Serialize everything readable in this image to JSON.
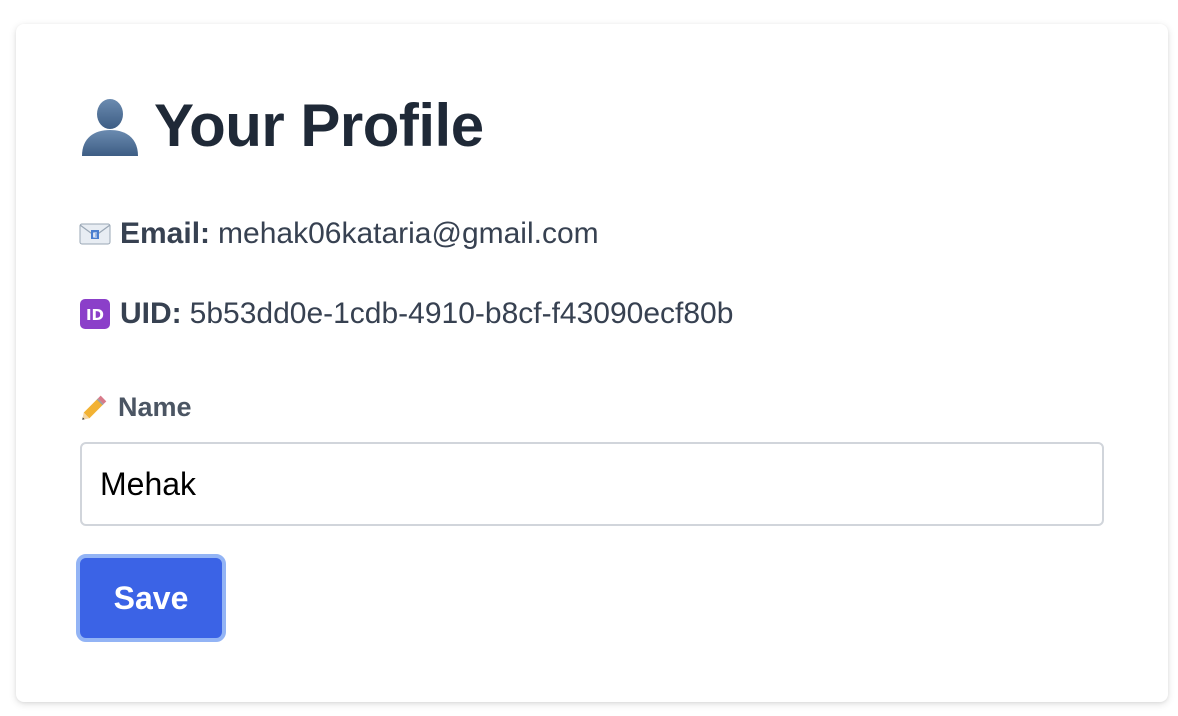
{
  "profile": {
    "title": "Your Profile",
    "title_icon": "user-silhouette-icon",
    "email_label": "Email:",
    "email_value": "mehak06kataria@gmail.com",
    "email_icon": "envelope-icon",
    "uid_label": "UID:",
    "uid_value": "5b53dd0e-1cdb-4910-b8cf-f43090ecf80b",
    "uid_icon": "id-badge-icon",
    "name_label": "Name",
    "name_icon": "pencil-icon",
    "name_value": "Mehak",
    "save_label": "Save"
  },
  "colors": {
    "primary": "#3b63e6",
    "focus_ring": "#93b4f5",
    "heading": "#1f2937",
    "text": "#374151",
    "id_badge": "#8b3fc9"
  }
}
